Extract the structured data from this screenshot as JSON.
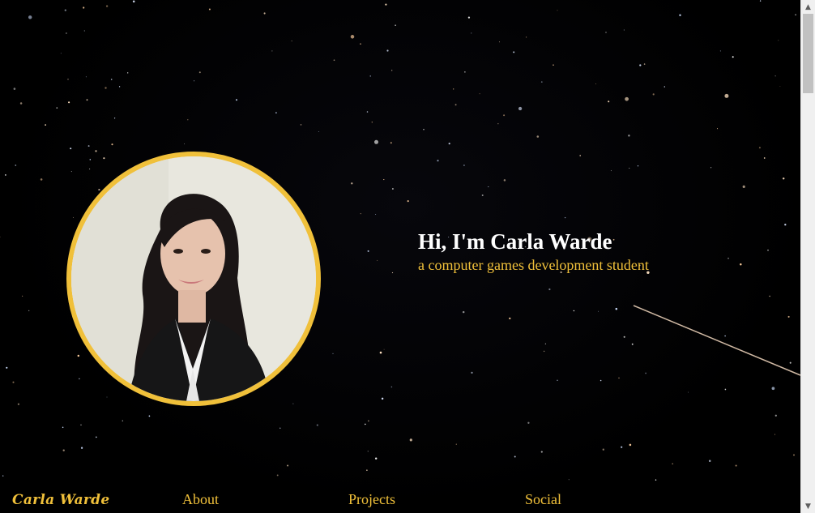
{
  "hero": {
    "title": "Hi, I'm Carla Warde",
    "subtitle": "a computer games development student"
  },
  "nav": {
    "logo": "Carla Warde",
    "items": [
      {
        "label": "About"
      },
      {
        "label": "Projects"
      },
      {
        "label": "Social"
      }
    ]
  },
  "colors": {
    "accent": "#f0c03a",
    "background": "#000000",
    "title": "#ffffff"
  },
  "icons": {
    "scroll_up": "chevron-up-icon",
    "scroll_down": "chevron-down-icon"
  }
}
